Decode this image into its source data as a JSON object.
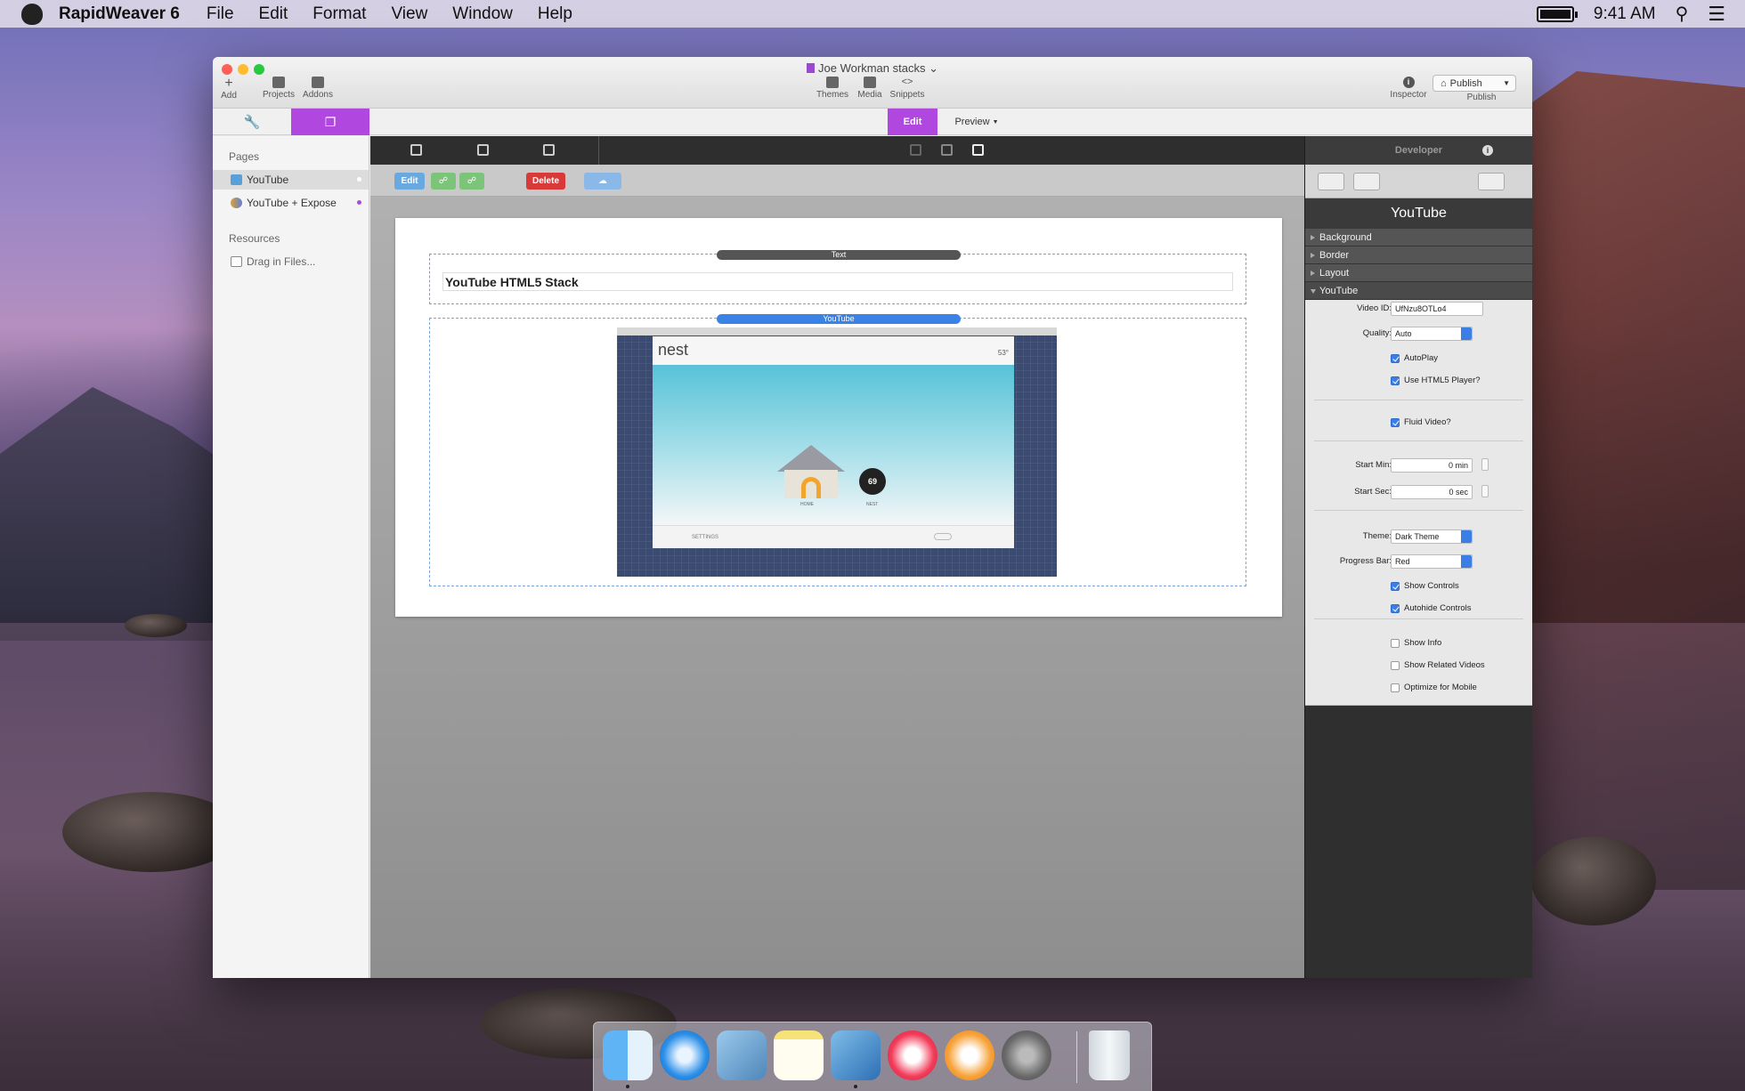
{
  "menubar": {
    "app_name": "RapidWeaver 6",
    "menus": [
      "File",
      "Edit",
      "Format",
      "View",
      "Window",
      "Help"
    ],
    "clock": "9:41 AM"
  },
  "window": {
    "title": "Joe Workman stacks",
    "toolbar_left": [
      "Add",
      "Projects",
      "Addons"
    ],
    "toolbar_center": [
      "Themes",
      "Media",
      "Snippets"
    ],
    "inspector_label": "Inspector",
    "publish_button": "Publish",
    "publish_label": "Publish"
  },
  "modes": {
    "edit": "Edit",
    "preview": "Preview"
  },
  "sidebar": {
    "pages_heading": "Pages",
    "pages": [
      {
        "label": "YouTube",
        "selected": true
      },
      {
        "label": "YouTube + Expose",
        "selected": false
      }
    ],
    "resources_heading": "Resources",
    "resources_item": "Drag in Files..."
  },
  "stacks_toolbar": {
    "edit": "Edit",
    "delete": "Delete"
  },
  "canvas": {
    "text_stack_tag": "Text",
    "text_stack_content": "YouTube HTML5 Stack",
    "youtube_stack_tag": "YouTube",
    "video": {
      "brand": "nest",
      "temperature": "53°",
      "dial_value": "69",
      "home_label": "HOME",
      "nest_label": "NEST",
      "settings_label": "SETTINGS"
    }
  },
  "inspector": {
    "header": "Developer",
    "title": "YouTube",
    "sections": [
      "Background",
      "Border",
      "Layout",
      "YouTube"
    ],
    "fields": {
      "video_id_label": "Video ID:",
      "video_id": "UfNzu8OTLo4",
      "quality_label": "Quality:",
      "quality": "Auto",
      "autoplay": "AutoPlay",
      "html5": "Use HTML5 Player?",
      "fluid": "Fluid Video?",
      "start_min_label": "Start Min:",
      "start_min": "0 min",
      "start_sec_label": "Start Sec:",
      "start_sec": "0 sec",
      "theme_label": "Theme:",
      "theme": "Dark Theme",
      "progress_label": "Progress Bar:",
      "progress": "Red",
      "show_controls": "Show Controls",
      "autohide": "Autohide Controls",
      "show_info": "Show Info",
      "show_related": "Show Related Videos",
      "optimize_mobile": "Optimize for Mobile"
    },
    "checkbox_states": {
      "autoplay": true,
      "html5": true,
      "fluid": true,
      "show_controls": true,
      "autohide": true,
      "show_info": false,
      "show_related": false,
      "optimize_mobile": false
    }
  },
  "dock": {
    "apps": [
      "finder-icon",
      "safari-icon",
      "mail-icon",
      "notes-icon",
      "xcode-icon",
      "itunes-icon",
      "ibooks-icon",
      "system-preferences-icon",
      "trash-icon"
    ]
  },
  "colors": {
    "accent_purple": "#b048e0",
    "delete_red": "#d83a3a",
    "checkbox_blue": "#3b7ee6"
  }
}
